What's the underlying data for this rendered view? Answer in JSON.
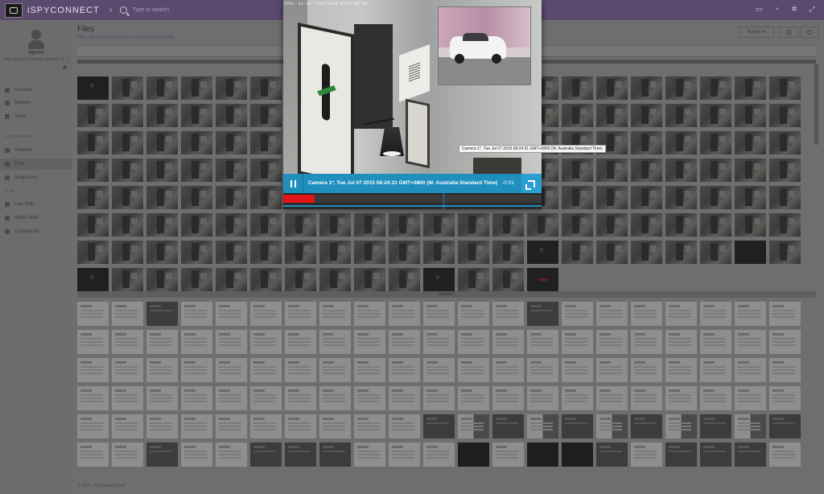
{
  "topbar": {
    "brand": "iSPYCONNECT",
    "search_placeholder": "Type to search",
    "icons": [
      "camera-icon",
      "bell-icon",
      "gear-icon",
      "expand-icon"
    ]
  },
  "user": {
    "name": "sporn",
    "role": "iSpy Access (FreePay Ultimate 2/...)"
  },
  "sidebar": {
    "items": [
      {
        "label": "Account",
        "icon": "account-icon"
      },
      {
        "label": "Servers",
        "icon": "eye-icon"
      },
      {
        "label": "Tools",
        "icon": "wrench-icon"
      }
    ],
    "recordings_header": "RECORDINGS",
    "recordings": [
      {
        "label": "Timeline",
        "icon": "timeline-icon"
      },
      {
        "label": "Files",
        "icon": "folder-icon",
        "active": true
      },
      {
        "label": "Snapshots",
        "icon": "camera-icon"
      }
    ],
    "live_header": "LIVE",
    "live": [
      {
        "label": "Live Stills",
        "icon": "live-icon"
      },
      {
        "label": "Video Wall",
        "icon": "video-wall-icon"
      },
      {
        "label": "Commands",
        "icon": "list-icon"
      }
    ]
  },
  "main": {
    "title": "Files",
    "filter": "Filter: Jun 30 2015 03:56 PM to Jul 07 2015 03:56 PM",
    "actions_label": "Actions ▾",
    "camera_section_label": "Camera 7"
  },
  "player": {
    "fps_text": "FPS: 11.16 7/07/2015 8:24:35 AM",
    "caption": "Camera 1*, Tue Jul 07 2015 08:24:31 GMT+0800 (W. Australia Standard Time)",
    "time_left": "-0:01",
    "progress_fraction": 0.12,
    "playhead_fraction": 0.62,
    "hover_tooltip": "Camera 1*, Tue Jul 07 2015 08:24:31 GMT+0800 (W. Australia Standard Time)",
    "accent_color": "#1f8fbd",
    "progress_color": "#e01515"
  },
  "footer": {
    "copyright": "© 2015 - iSpyConnect.com"
  }
}
